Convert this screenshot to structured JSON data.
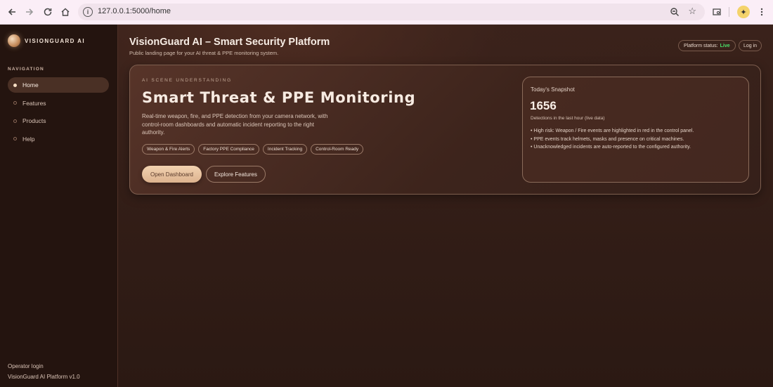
{
  "browser": {
    "url": "127.0.0.1:5000/home"
  },
  "sidebar": {
    "brand": "VISIONGUARD AI",
    "nav_heading": "NAVIGATION",
    "items": [
      {
        "label": "Home"
      },
      {
        "label": "Features"
      },
      {
        "label": "Products"
      },
      {
        "label": "Help"
      }
    ],
    "active_item": "Home",
    "footer_login": "Operator login",
    "footer_version": "VisionGuard AI Platform v1.0"
  },
  "header": {
    "title": "VisionGuard AI – Smart Security Platform",
    "subtitle": "Public landing page for your AI threat & PPE monitoring system.",
    "status_label": "Platform status:",
    "status_value": "Live",
    "login_label": "Log in"
  },
  "hero": {
    "eyebrow": "AI SCENE UNDERSTANDING",
    "title": "Smart Threat & PPE Monitoring",
    "description": "Real-time weapon, fire, and PPE detection from your camera network, with control-room dashboards and automatic incident reporting to the right authority.",
    "tags": [
      "Weapon & Fire Alerts",
      "Factory PPE Compliance",
      "Incident Tracking",
      "Control-Room Ready"
    ],
    "primary_button": "Open Dashboard",
    "secondary_button": "Explore Features"
  },
  "snapshot": {
    "title": "Today's Snapshot",
    "value": "1656",
    "caption": "Detections in the last hour (live data)",
    "bullets": [
      "High risk: Weapon / Fire events are highlighted in red in the control panel.",
      "PPE events track helmets, masks and presence on critical machines.",
      "Unacknowledged incidents are auto-reported to the configured authority."
    ]
  },
  "colors": {
    "accent": "#ddb38f",
    "live_status": "#4be36a",
    "background": "#2a1813"
  }
}
